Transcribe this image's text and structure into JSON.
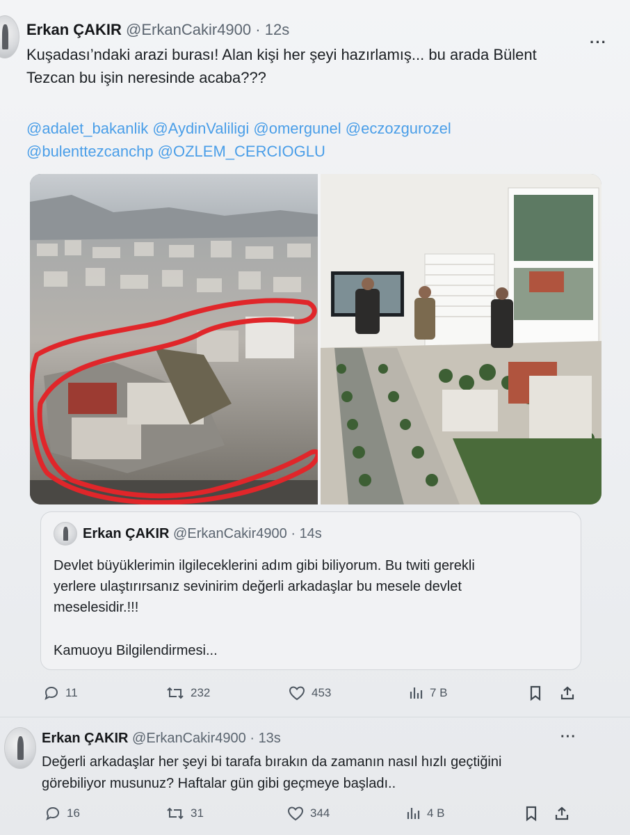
{
  "tweet1": {
    "author_name": "Erkan ÇAKIR",
    "handle": "@ErkanCakir4900",
    "separator": "·",
    "time": "12s",
    "more": "···",
    "text_line1": "Kuşadası’ndaki arazi burası! Alan kişi her şeyi hazırlamış... bu arada Bülent",
    "text_line2": "Tezcan bu işin neresinde acaba???",
    "mentions_line1": "@adalet_bakanlik @AydinValiligi @omergunel @eczozgurozel",
    "mentions_line2": "@bulenttezcanchp @OZLEM_CERCIOGLU",
    "quote": {
      "author_name": "Erkan ÇAKIR",
      "handle": "@ErkanCakir4900",
      "separator": "·",
      "time": "14s",
      "text_line1": "Devlet büyüklerimin ilgileceklerini adım gibi biliyorum. Bu twiti gerekli",
      "text_line2": "yerlere ulaştırırsanız sevinirim değerli arkadaşlar bu mesele devlet",
      "text_line3": "meselesidir.!!!",
      "text_line4": "Kamuoyu Bilgilendirmesi..."
    },
    "actions": {
      "replies": "11",
      "reposts": "232",
      "likes": "453",
      "views": "7 B"
    }
  },
  "tweet2": {
    "author_name": "Erkan ÇAKIR",
    "handle": "@ErkanCakir4900",
    "separator": "·",
    "time": "13s",
    "more": "···",
    "text_line1": "Değerli arkadaşlar her şeyi bi tarafa bırakın da zamanın nasıl hızlı geçtiğini",
    "text_line2": "görebiliyor musunuz? Haftalar gün gibi geçmeye  başladı..",
    "actions": {
      "replies": "16",
      "reposts": "31",
      "likes": "344",
      "views": "4 B"
    }
  },
  "icons": {
    "reply": "reply-icon",
    "repost": "repost-icon",
    "like": "heart-icon",
    "views": "views-icon",
    "bookmark": "bookmark-icon",
    "share": "share-icon"
  },
  "colors": {
    "link": "#4a9ee8",
    "text": "#1b1f23",
    "muted": "#5b6570",
    "highlight_outline": "#e0262a"
  }
}
